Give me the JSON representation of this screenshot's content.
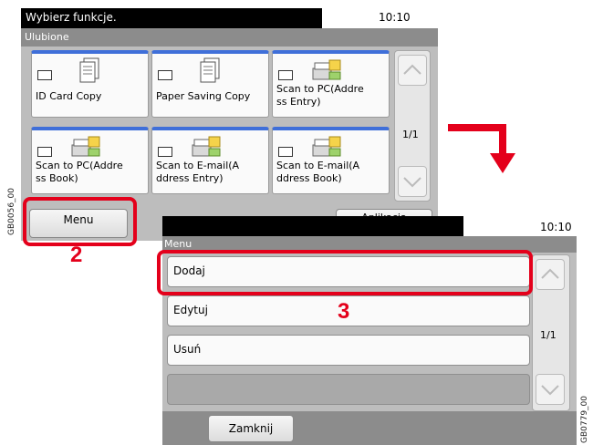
{
  "screen1": {
    "title": "Wybierz funkcje.",
    "time": "10:10",
    "subtitle": "Ulubione",
    "tiles": [
      {
        "label": "ID Card Copy",
        "icon": "id-card-copy-icon"
      },
      {
        "label": "Paper Saving Copy",
        "icon": "paper-saving-copy-icon"
      },
      {
        "line1": "Scan to PC(Addre",
        "line2": "ss Entry)",
        "icon": "scan-to-pc-icon"
      },
      {
        "line1": "Scan to PC(Addre",
        "line2": "ss Book)",
        "icon": "scan-to-pc-icon"
      },
      {
        "line1": "Scan to E-mail(A",
        "line2": "ddress Entry)",
        "icon": "scan-to-email-icon"
      },
      {
        "line1": "Scan to E-mail(A",
        "line2": "ddress Book)",
        "icon": "scan-to-email-icon"
      }
    ],
    "page": "1/1",
    "menu_label": "Menu",
    "app_label": "Aplikacja",
    "side_code": "GB0056_00",
    "step_number": "2"
  },
  "screen2": {
    "time": "10:10",
    "subtitle": "Menu",
    "items": [
      "Dodaj",
      "Edytuj",
      "Usuń"
    ],
    "page": "1/1",
    "close_label": "Zamknij",
    "side_code": "GB0779_00",
    "step_number": "3"
  },
  "colors": {
    "highlight": "#e4001b",
    "tile_accent": "#3f6fd9"
  }
}
